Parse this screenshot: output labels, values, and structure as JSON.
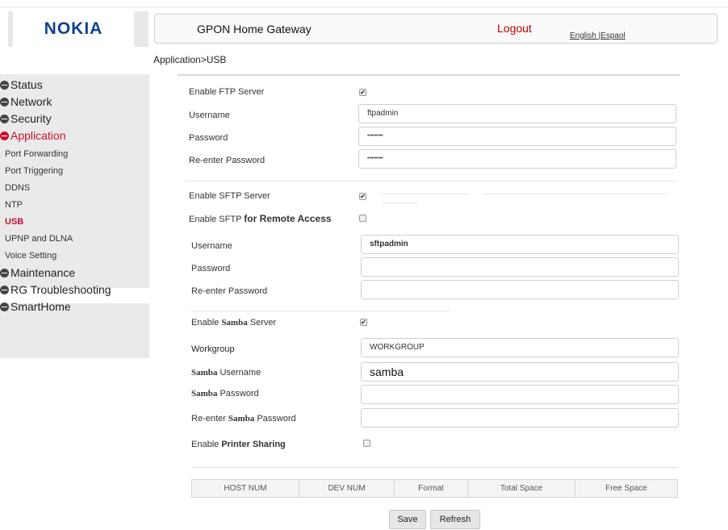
{
  "brand": {
    "logo_text": "NOKIA"
  },
  "header": {
    "title": "GPON Home Gateway",
    "logout": "Logout",
    "lang_english": "English",
    "lang_sep": " |",
    "lang_espanol": "Espaol"
  },
  "breadcrumb": "Application>USB",
  "sidebar": {
    "sections": [
      "Status",
      "Network",
      "Security",
      "Application",
      "Maintenance",
      "RG Troubleshooting",
      "SmartHome"
    ],
    "sub_items": [
      "Port Forwarding",
      "Port Triggering",
      "DDNS",
      "NTP",
      "USB",
      "UPNP and DLNA",
      "Voice Setting"
    ]
  },
  "ftp": {
    "enable_label": "Enable FTP Server",
    "enabled": true,
    "username_label": "Username",
    "username_value": "ftpadmin",
    "password_label": "Password",
    "password_value": "••••••••",
    "reenter_label": "Re-enter Password",
    "reenter_value": "••••••••"
  },
  "sftp": {
    "enable_label": "Enable SFTP Server",
    "enabled": true,
    "remote_label_pre": "Enable SFTP ",
    "remote_label_bold": "for Remote Access",
    "remote_enabled": false,
    "username_label": "Username",
    "username_value": "sftpadmin",
    "password_label": "Password",
    "password_value": "",
    "reenter_label": "Re-enter Password",
    "reenter_value": ""
  },
  "samba": {
    "enable_pre": "Enable ",
    "enable_bold": "Samba",
    "enable_post": " Server",
    "enabled": true,
    "workgroup_label": "Workgroup",
    "workgroup_value": "WORKGROUP",
    "username_bold": "Samba",
    "username_post": " Username",
    "username_value": "samba",
    "password_bold": "Samba",
    "password_post": " Password",
    "password_value": "",
    "reenter_pre": "Re-enter ",
    "reenter_bold": "Samba",
    "reenter_post": " Password",
    "reenter_value": "",
    "printer_pre": "Enable ",
    "printer_bold": "Printer Sharing",
    "printer_enabled": false
  },
  "table": {
    "headers": [
      "HOST NUM",
      "DEV NUM",
      "Format",
      "Total Space",
      "Free Space"
    ]
  },
  "buttons": {
    "save": "Save",
    "refresh": "Refresh"
  },
  "colors": {
    "accent_red": "#c8102e",
    "brand_blue": "#124191",
    "logout_red": "#c00000"
  }
}
